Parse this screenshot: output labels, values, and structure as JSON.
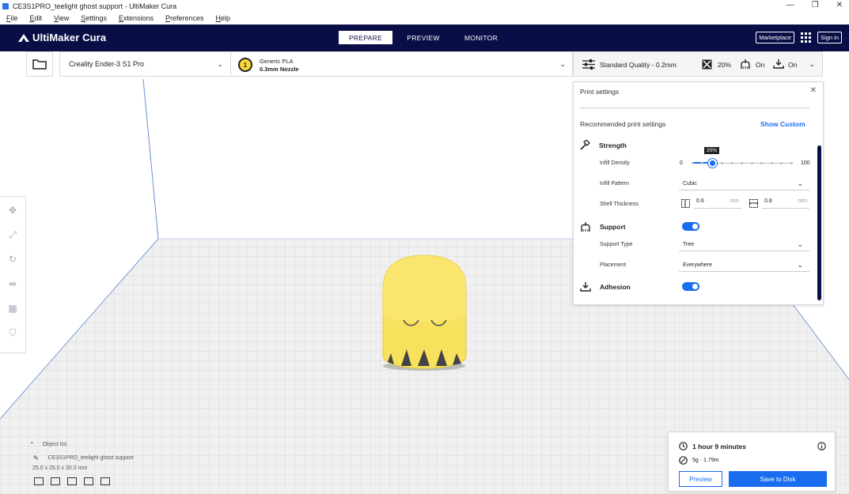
{
  "window": {
    "title": "CE3S1PRO_teelight ghost support - UltiMaker Cura",
    "controls": [
      "—",
      "❐",
      "✕"
    ]
  },
  "menu": [
    "File",
    "Edit",
    "View",
    "Settings",
    "Extensions",
    "Preferences",
    "Help"
  ],
  "header": {
    "logo": "UltiMaker Cura",
    "stages": [
      "PREPARE",
      "PREVIEW",
      "MONITOR"
    ],
    "active_stage": "PREPARE",
    "marketplace": "Marketplace",
    "sign_in": "Sign in"
  },
  "toolbar": {
    "printer": "Creality Ender-3 S1 Pro",
    "material_badge": "1",
    "material_name": "Generic PLA",
    "nozzle": "0.3mm Nozzle",
    "profile": "Standard Quality - 0.2mm",
    "infill_summary": "20%",
    "support_summary": "On",
    "adhesion_summary": "On"
  },
  "print_settings": {
    "title": "Print settings",
    "recommended": "Recommended print settings",
    "show_custom": "Show Custom",
    "strength": "Strength",
    "infill_density_label": "Infill Density",
    "infill_min": "0",
    "infill_max": "100",
    "infill_value": 20,
    "infill_tooltip": "20%",
    "infill_pattern_label": "Infill Pattern",
    "infill_pattern": "Cubic",
    "shell_label": "Shell Thickness",
    "wall_thickness": "0.6",
    "top_bottom_thickness": "0.8",
    "unit": "mm",
    "support": "Support",
    "support_enabled": true,
    "support_type_label": "Support Type",
    "support_type": "Tree",
    "placement_label": "Placement",
    "placement": "Everywhere",
    "adhesion": "Adhesion",
    "adhesion_enabled": true
  },
  "object_list": {
    "label": "Object list",
    "object_name": "CE3S1PRO_teelight ghost support",
    "dimensions": "25.0 x 25.0 x 30.0 mm"
  },
  "estimate": {
    "time": "1 hour 9 minutes",
    "material": "5g · 1.79m",
    "preview_button": "Preview",
    "save_button": "Save to Disk"
  },
  "colors": {
    "header_bg": "#0a0e47",
    "accent": "#196ef0",
    "model": "#f8e15c"
  }
}
